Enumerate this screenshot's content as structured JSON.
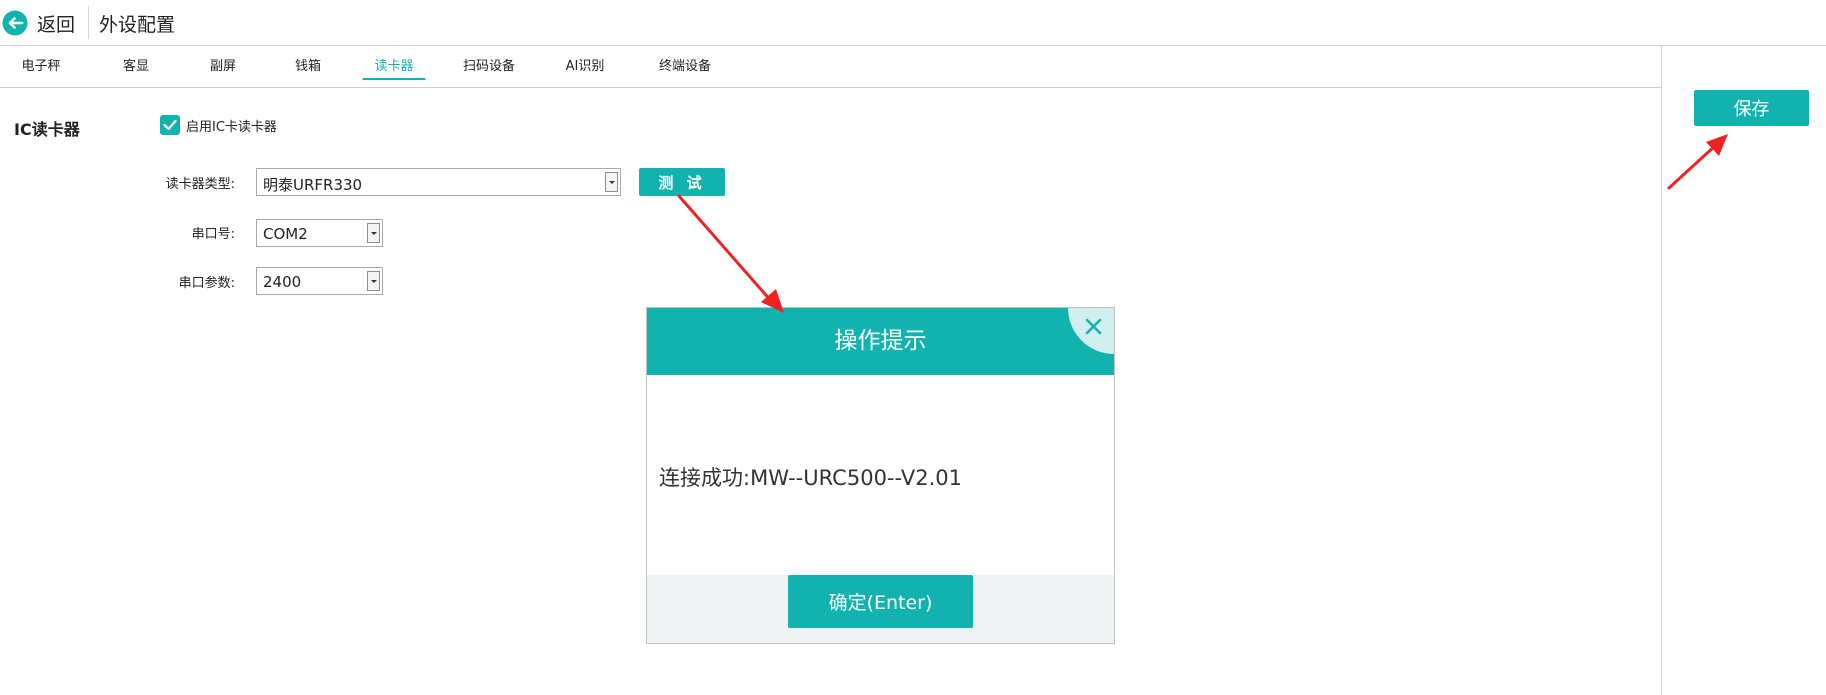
{
  "header": {
    "back_label": "返回",
    "title": "外设配置"
  },
  "tabs": [
    {
      "label": "电子秤"
    },
    {
      "label": "客显"
    },
    {
      "label": "副屏"
    },
    {
      "label": "钱箱"
    },
    {
      "label": "读卡器",
      "active": true
    },
    {
      "label": "扫码设备"
    },
    {
      "label": "AI识别"
    },
    {
      "label": "终端设备"
    }
  ],
  "reader": {
    "section_title": "IC读卡器",
    "enable_label": "启用IC卡读卡器",
    "enable_checked": true,
    "type_label": "读卡器类型:",
    "type_value": "明泰URFR330",
    "port_label": "串口号:",
    "port_value": "COM2",
    "param_label": "串口参数:",
    "param_value": "2400",
    "test_label": "测 试"
  },
  "save_label": "保存",
  "dialog": {
    "title": "操作提示",
    "message": "连接成功:MW--URC500--V2.01",
    "confirm_label": "确定(Enter)"
  },
  "colors": {
    "accent": "#12b3ae",
    "annotation_arrow": "#ee2222"
  },
  "icons": {
    "back": "back-arrow-circle-icon",
    "close": "close-icon",
    "check": "check-icon",
    "dropdown": "chevron-down-icon"
  }
}
